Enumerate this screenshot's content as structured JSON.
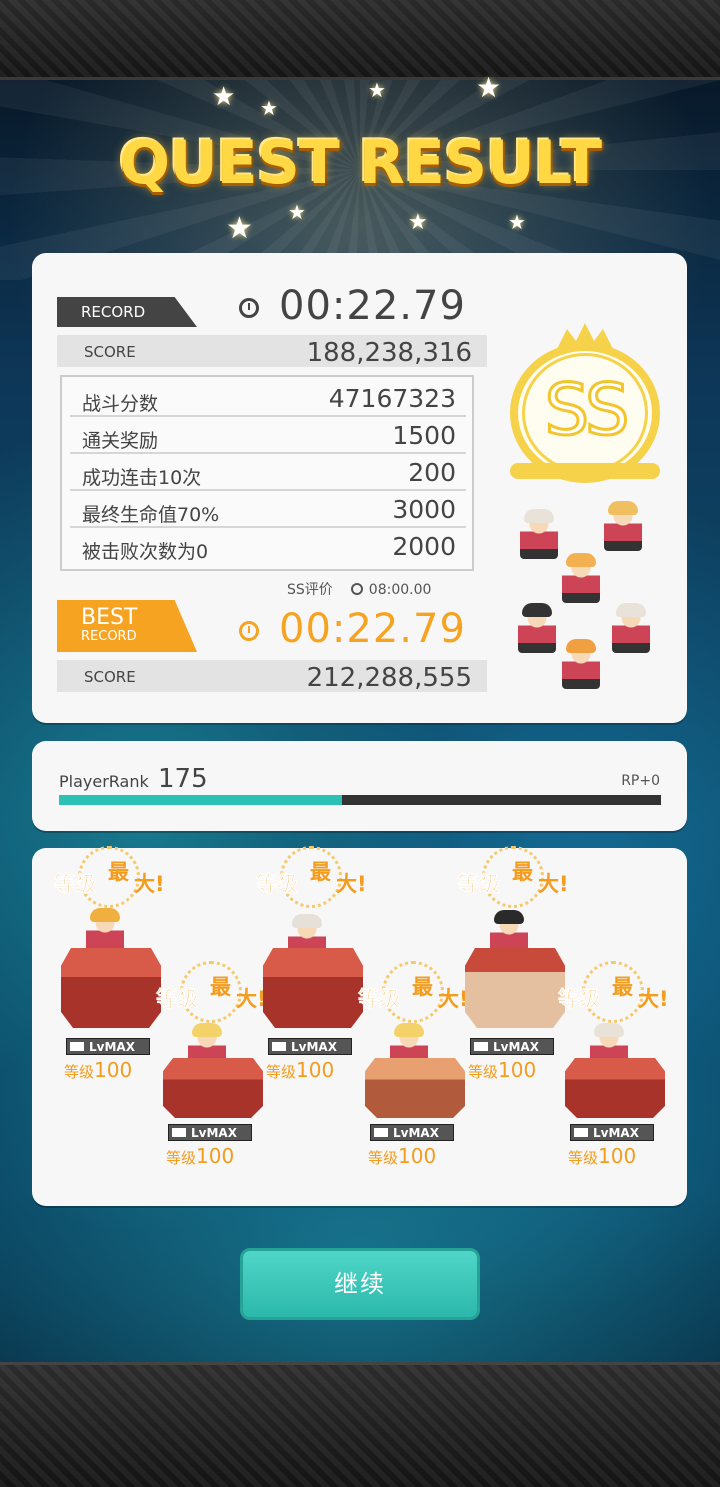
{
  "title": "QUEST RESULT",
  "record": {
    "tag": "RECORD",
    "time": "00:22.79",
    "score_label": "SCORE",
    "score": "188,238,316"
  },
  "breakdown": [
    {
      "label": "战斗分数",
      "value": "47167323"
    },
    {
      "label": "通关奖励",
      "value": "1500"
    },
    {
      "label": "成功连击10次",
      "value": "200"
    },
    {
      "label": "最终生命值70%",
      "value": "3000"
    },
    {
      "label": "被击败次数为0",
      "value": "2000"
    }
  ],
  "ss_requirement": {
    "label": "SS评价",
    "time": "08:00.00"
  },
  "best": {
    "tag_big": "BEST",
    "tag_small": "RECORD",
    "time": "00:22.79",
    "score_label": "SCORE",
    "score": "212,288,555"
  },
  "grade": "SS",
  "player": {
    "rank_label": "PlayerRank",
    "rank": "175",
    "rp": "RP+0",
    "progress": 0.47
  },
  "units": [
    {
      "max_a": "等级",
      "max_b": "最",
      "max_c": "大!",
      "lvmax": "LvMAX",
      "level_prefix": "等级",
      "level": "100"
    },
    {
      "max_a": "等级",
      "max_b": "最",
      "max_c": "大!",
      "lvmax": "LvMAX",
      "level_prefix": "等级",
      "level": "100"
    },
    {
      "max_a": "等级",
      "max_b": "最",
      "max_c": "大!",
      "lvmax": "LvMAX",
      "level_prefix": "等级",
      "level": "100"
    },
    {
      "max_a": "等级",
      "max_b": "最",
      "max_c": "大!",
      "lvmax": "LvMAX",
      "level_prefix": "等级",
      "level": "100"
    },
    {
      "max_a": "等级",
      "max_b": "最",
      "max_c": "大!",
      "lvmax": "LvMAX",
      "level_prefix": "等级",
      "level": "100"
    },
    {
      "max_a": "等级",
      "max_b": "最",
      "max_c": "大!",
      "lvmax": "LvMAX",
      "level_prefix": "等级",
      "level": "100"
    }
  ],
  "continue_label": "继续",
  "colors": {
    "accent": "#2bc1b4",
    "best": "#f7a322",
    "gold": "#ffd844",
    "level": "#f39c1e"
  }
}
